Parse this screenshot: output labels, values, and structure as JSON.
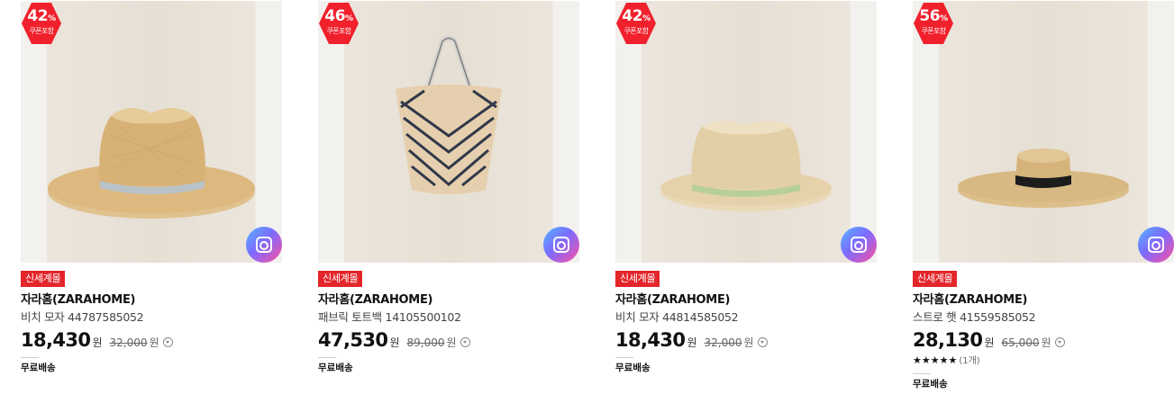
{
  "products": [
    {
      "discount": "42",
      "discount_unit": "%",
      "coupon_label": "쿠폰포함",
      "store_tag": "신세계몰",
      "brand": "자라홈(ZARAHOME)",
      "name": "비치 모자 44787585052",
      "price": "18,430",
      "price_unit": "원",
      "original_price": "32,000",
      "original_unit": "원",
      "shipping": "무료배송",
      "image_icon": "fedora-hat-blue-band"
    },
    {
      "discount": "46",
      "discount_unit": "%",
      "coupon_label": "쿠폰포함",
      "store_tag": "신세계몰",
      "brand": "자라홈(ZARAHOME)",
      "name": "패브릭 토트백 14105500102",
      "price": "47,530",
      "price_unit": "원",
      "original_price": "89,000",
      "original_unit": "원",
      "shipping": "무료배송",
      "image_icon": "chevron-tote-bag"
    },
    {
      "discount": "42",
      "discount_unit": "%",
      "coupon_label": "쿠폰포함",
      "store_tag": "신세계몰",
      "brand": "자라홈(ZARAHOME)",
      "name": "비치 모자 44814585052",
      "price": "18,430",
      "price_unit": "원",
      "original_price": "32,000",
      "original_unit": "원",
      "shipping": "무료배송",
      "image_icon": "fedora-hat-green-band"
    },
    {
      "discount": "56",
      "discount_unit": "%",
      "coupon_label": "쿠폰포함",
      "store_tag": "신세계몰",
      "brand": "자라홈(ZARAHOME)",
      "name": "스트로 햇 41559585052",
      "price": "28,130",
      "price_unit": "원",
      "original_price": "65,000",
      "original_unit": "원",
      "rating_stars": "★★★★★",
      "rating_count": "(1개)",
      "shipping": "무료배송",
      "image_icon": "boater-hat-black-band"
    }
  ],
  "colors": {
    "badge_red": "#f0212c",
    "tag_red": "#e3262a",
    "lens_gradient": [
      "#55b6ff",
      "#7b6bff",
      "#ff4fa0"
    ]
  },
  "icons": {
    "image_search": "camera-lens-icon",
    "price_info": "chevron-down-circle-icon"
  }
}
